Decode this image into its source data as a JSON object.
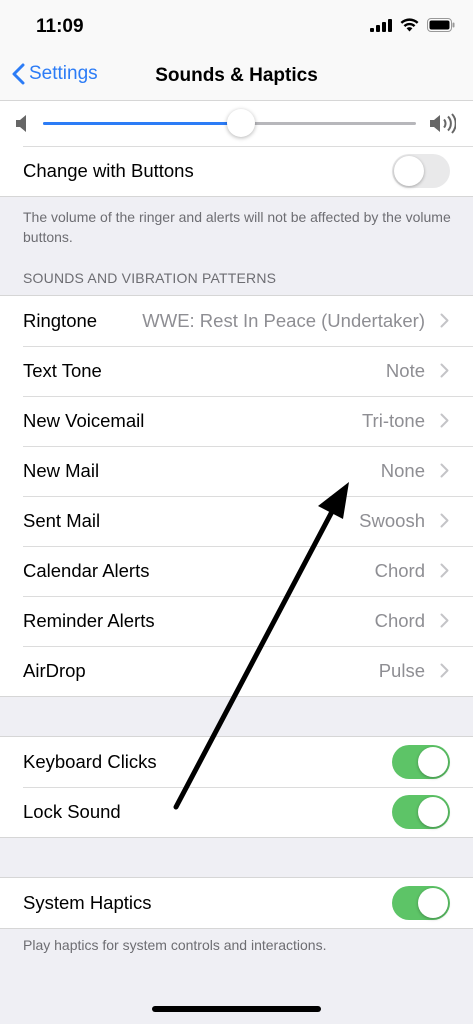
{
  "status_bar": {
    "time": "11:09"
  },
  "nav": {
    "back_label": "Settings",
    "title": "Sounds & Haptics"
  },
  "volume": {
    "level": 0.53
  },
  "change_with_buttons": {
    "label": "Change with Buttons",
    "on": false
  },
  "volume_note": "The volume of the ringer and alerts will not be affected by the volume buttons.",
  "sounds_header": "SOUNDS AND VIBRATION PATTERNS",
  "sounds": [
    {
      "label": "Ringtone",
      "value": "WWE: Rest In Peace (Undertaker)"
    },
    {
      "label": "Text Tone",
      "value": "Note"
    },
    {
      "label": "New Voicemail",
      "value": "Tri-tone"
    },
    {
      "label": "New Mail",
      "value": "None"
    },
    {
      "label": "Sent Mail",
      "value": "Swoosh"
    },
    {
      "label": "Calendar Alerts",
      "value": "Chord"
    },
    {
      "label": "Reminder Alerts",
      "value": "Chord"
    },
    {
      "label": "AirDrop",
      "value": "Pulse"
    }
  ],
  "keyboard_clicks": {
    "label": "Keyboard Clicks",
    "on": true
  },
  "lock_sound": {
    "label": "Lock Sound",
    "on": true
  },
  "system_haptics": {
    "label": "System Haptics",
    "on": true
  },
  "haptics_note": "Play haptics for system controls and interactions.",
  "colors": {
    "accent": "#2c7cf6",
    "toggle_on": "#5dc467",
    "background": "#efeff4"
  },
  "icons": [
    "signal-icon",
    "wifi-icon",
    "battery-icon",
    "chevron-left-icon",
    "speaker-low-icon",
    "speaker-high-icon",
    "chevron-right-icon"
  ]
}
